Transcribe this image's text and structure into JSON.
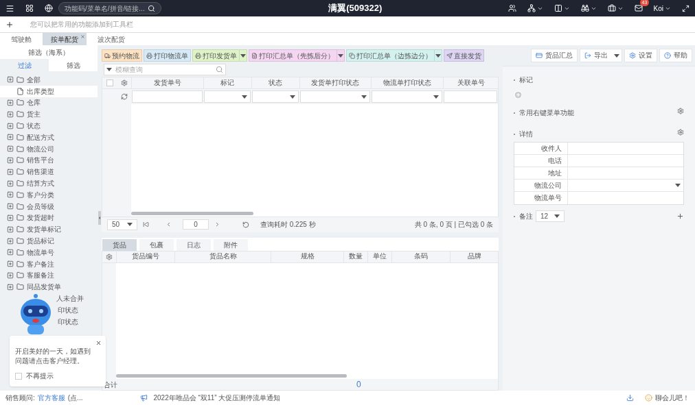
{
  "topbar": {
    "search": {
      "placeholder": "功能码/菜单名/拼音/链接..."
    },
    "title": "满翼(509322)",
    "badge": "43",
    "user": "Koi"
  },
  "toolbar": {
    "hint": "您可以把常用的功能添加到工具栏"
  },
  "page_tabs": [
    {
      "label": "驾驶舱",
      "selected": false,
      "closable": false
    },
    {
      "label": "按单配货",
      "selected": true,
      "closable": true
    },
    {
      "label": "波次配货",
      "selected": false,
      "closable": false
    }
  ],
  "sidebar": {
    "title": "筛选（海系）",
    "tabs": [
      {
        "label": "过滤",
        "selected": true
      },
      {
        "label": "筛选",
        "selected": false
      }
    ],
    "items": [
      {
        "label": "全部",
        "kind": "folder",
        "covered": false
      },
      {
        "label": "出库类型",
        "kind": "file",
        "covered": false
      },
      {
        "label": "仓库",
        "kind": "folder",
        "covered": false
      },
      {
        "label": "货主",
        "kind": "folder",
        "covered": false
      },
      {
        "label": "状态",
        "kind": "folder",
        "covered": false
      },
      {
        "label": "配送方式",
        "kind": "folder",
        "covered": false
      },
      {
        "label": "物流公司",
        "kind": "folder",
        "covered": false
      },
      {
        "label": "销售平台",
        "kind": "folder",
        "covered": false
      },
      {
        "label": "销售渠道",
        "kind": "folder",
        "covered": false
      },
      {
        "label": "结算方式",
        "kind": "folder",
        "covered": false
      },
      {
        "label": "客户分类",
        "kind": "folder",
        "covered": false
      },
      {
        "label": "会员等级",
        "kind": "folder",
        "covered": false
      },
      {
        "label": "发货超时",
        "kind": "folder",
        "covered": false
      },
      {
        "label": "发货单标记",
        "kind": "folder",
        "covered": false
      },
      {
        "label": "货品标记",
        "kind": "folder",
        "covered": false
      },
      {
        "label": "物流单号",
        "kind": "folder",
        "covered": false
      },
      {
        "label": "客户备注",
        "kind": "folder",
        "covered": false
      },
      {
        "label": "客服备注",
        "kind": "folder",
        "covered": false
      },
      {
        "label": "同品发货单",
        "kind": "folder",
        "covered": false
      },
      {
        "label": "人未合并",
        "kind": "file",
        "covered": true
      },
      {
        "label": "印状态",
        "kind": "folder",
        "covered": true
      },
      {
        "label": "印状态",
        "kind": "folder",
        "covered": true
      }
    ]
  },
  "actions": [
    {
      "label": "预约物流",
      "color": "#fde3c4",
      "dropdown": false
    },
    {
      "label": "打印物流单",
      "color": "#d6ebf7",
      "dropdown": false
    },
    {
      "label": "打印发货单",
      "color": "#dff3c8",
      "dropdown": true
    },
    {
      "label": "打印汇总单（先拣后分）",
      "color": "#f4d6f2",
      "dropdown": true
    },
    {
      "label": "打印汇总单（边拣边分）",
      "color": "#d3f1ee",
      "dropdown": true
    },
    {
      "label": "直接发货",
      "color": "#ddd5f3",
      "dropdown": false
    }
  ],
  "right_actions": [
    {
      "label": "货品汇总",
      "dropdown": false
    },
    {
      "label": "导出",
      "dropdown": true
    },
    {
      "label": "设置",
      "dropdown": false
    },
    {
      "label": "帮助",
      "dropdown": false
    }
  ],
  "query": {
    "placeholder": "模糊查询"
  },
  "grid": {
    "select_all": false,
    "columns": [
      {
        "label": "发货单号",
        "kind": "text"
      },
      {
        "label": "标记",
        "kind": "select"
      },
      {
        "label": "状态",
        "kind": "select"
      },
      {
        "label": "发货单打印状态",
        "kind": "select"
      },
      {
        "label": "物流单打印状态",
        "kind": "select"
      },
      {
        "label": "关联单号",
        "kind": "text"
      }
    ]
  },
  "pager": {
    "page_size": "50",
    "page": "0",
    "elapsed": "查询耗时 0.225 秒",
    "summary": "共 0 条, 0 页 | 已勾选 0 条"
  },
  "detail_tabs": [
    {
      "label": "货品",
      "selected": true
    },
    {
      "label": "包裹",
      "selected": false
    },
    {
      "label": "日志",
      "selected": false
    },
    {
      "label": "附件",
      "selected": false
    }
  ],
  "detail_columns": [
    "货品编号",
    "货品名称",
    "规格",
    "数量",
    "单位",
    "条码",
    "品牌"
  ],
  "totals": {
    "label": "合计",
    "value": "0"
  },
  "panel": {
    "tags": "标记",
    "menu": "常用右键菜单功能",
    "details": "详情",
    "fields": [
      {
        "label": "收件人",
        "kind": "text"
      },
      {
        "label": "电话",
        "kind": "text"
      },
      {
        "label": "地址",
        "kind": "text"
      },
      {
        "label": "物流公司",
        "kind": "select"
      },
      {
        "label": "物流单号",
        "kind": "text"
      }
    ],
    "remark": "备注",
    "remark_value": "12"
  },
  "popup": {
    "message": "开启美好的一天，如遇到问题请点击客户经理。",
    "checkbox": "不再提示",
    "checked": false
  },
  "status_bar": {
    "advisor": "销售顾问:",
    "advisor_link": "官方客服",
    "advisor_more": "(点...",
    "notice": "2022年唯品会 “双11” 大促压测停流单通知",
    "chat": "聊会儿吧！"
  }
}
